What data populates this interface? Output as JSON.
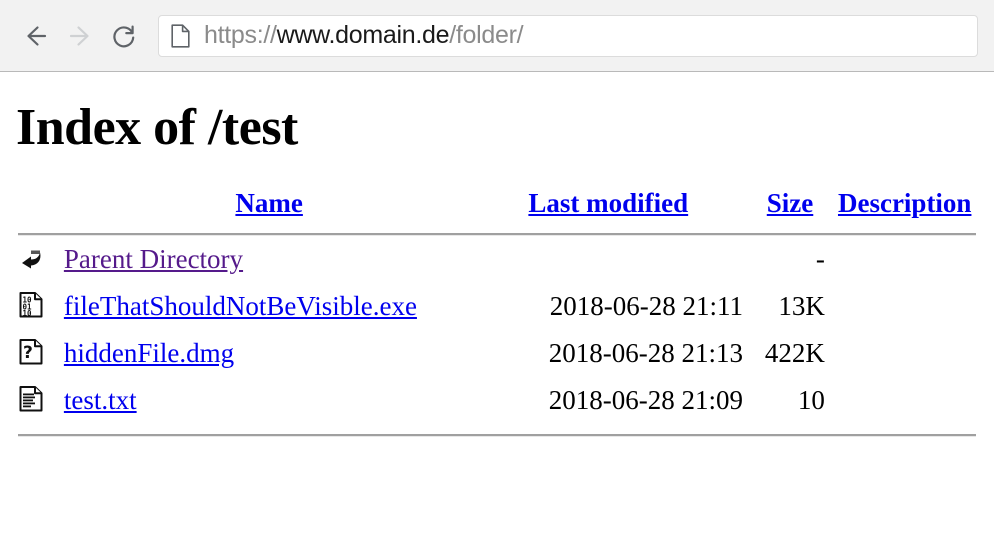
{
  "browser": {
    "back_label": "Back",
    "forward_label": "Forward",
    "reload_label": "Reload",
    "page_icon_name": "page-icon",
    "url": {
      "scheme": "https://",
      "host": "www.domain.de",
      "path": "/folder/"
    }
  },
  "page": {
    "title": "Index of /test",
    "headers": {
      "name": "Name",
      "last_modified": "Last modified",
      "size": "Size",
      "description": "Description"
    },
    "rows": [
      {
        "icon": "back-arrow-icon",
        "name": "Parent Directory",
        "last_modified": "",
        "size": "-",
        "description": "",
        "visited": true
      },
      {
        "icon": "binary-file-icon",
        "name": "fileThatShouldNotBeVisible.exe",
        "last_modified": "2018-06-28 21:11",
        "size": "13K",
        "description": "",
        "visited": false
      },
      {
        "icon": "unknown-file-icon",
        "name": "hiddenFile.dmg",
        "last_modified": "2018-06-28 21:13",
        "size": "422K",
        "description": "",
        "visited": false
      },
      {
        "icon": "text-file-icon",
        "name": "test.txt",
        "last_modified": "2018-06-28 21:09",
        "size": "10",
        "description": "",
        "visited": false
      }
    ]
  },
  "colors": {
    "link": "#0000ee",
    "visited_link": "#551a8b",
    "toolbar_bg": "#f2f2f2",
    "rule": "#a0a0a0"
  }
}
